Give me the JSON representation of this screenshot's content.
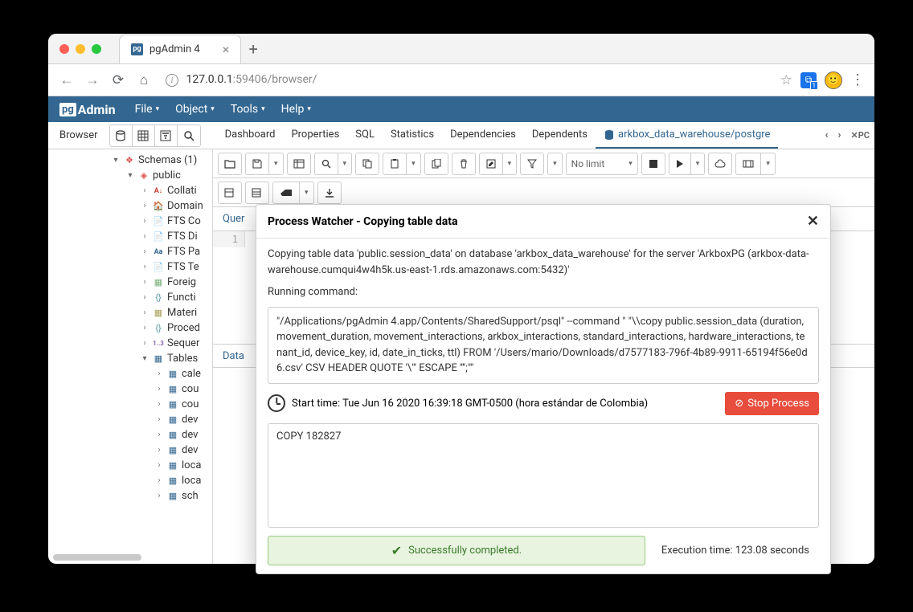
{
  "browser": {
    "tab_title": "pgAdmin 4",
    "url_host": "127.0.0.1",
    "url_port_path": ":59406/browser/",
    "extension_badge": "1"
  },
  "menubar": {
    "logo_pg": "pg",
    "logo_admin": "Admin",
    "items": [
      "File",
      "Object",
      "Tools",
      "Help"
    ]
  },
  "browserpanel": {
    "label": "Browser"
  },
  "maintabs": {
    "items": [
      "Dashboard",
      "Properties",
      "SQL",
      "Statistics",
      "Dependencies",
      "Dependents"
    ],
    "active": "arkbox_data_warehouse/postgre",
    "overflow_close": "✕"
  },
  "query_toolbar": {
    "limit": "No limit"
  },
  "query_tabs": {
    "tab1": "Quer"
  },
  "editor": {
    "line1": "1"
  },
  "data_tabs": {
    "tab1": "Data"
  },
  "tree": {
    "schemas": "Schemas (1)",
    "public": "public",
    "items": [
      "Collati",
      "Domain",
      "FTS Co",
      "FTS Di",
      "FTS Pa",
      "FTS Te",
      "Foreig",
      "Functi",
      "Materi",
      "Proced",
      "Sequer"
    ],
    "tables": "Tables",
    "table_items": [
      "cale",
      "cou",
      "cou",
      "dev",
      "dev",
      "dev",
      "loca",
      "loca",
      "sch"
    ]
  },
  "modal": {
    "title": "Process Watcher - Copying table data",
    "description": "Copying table data 'public.session_data' on database 'arkbox_data_warehouse' for the server 'ArkboxPG (arkbox-data-warehouse.cumqui4w4h5k.us-east-1.rds.amazonaws.com:5432)'",
    "running_label": "Running command:",
    "command": "\"/Applications/pgAdmin 4.app/Contents/SharedSupport/psql\" --command \" \"\\\\copy public.session_data (duration, movement_duration, movement_interactions, arkbox_interactions, standard_interactions, hardware_interactions, tenant_id, device_key, id, date_in_ticks, ttl) FROM '/Users/mario/Downloads/d7577183-796f-4b89-9911-65194f56e0d6.csv' CSV HEADER QUOTE '\\\"' ESCAPE '''';\"\"",
    "start_time": "Start time: Tue Jun 16 2020 16:39:18 GMT-0500 (hora estándar de Colombia)",
    "stop_label": "Stop Process",
    "output": "COPY 182827",
    "success": "Successfully completed.",
    "exec_label": "Execution time:",
    "exec_value": "123.08 seconds"
  }
}
